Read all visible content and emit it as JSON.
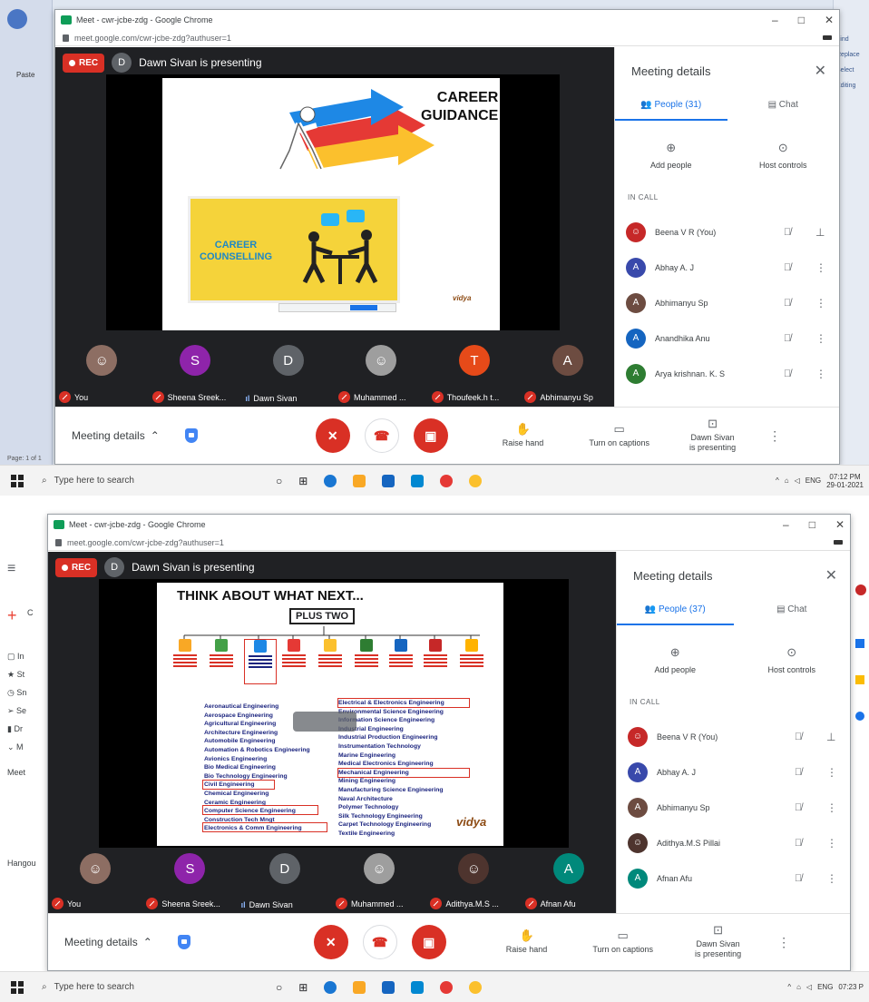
{
  "screens": [
    {
      "window_title": "Meet - cwr-jcbe-zdg - Google Chrome",
      "url": "meet.google.com/cwr-jcbe-zdg?authuser=1",
      "rec_label": "REC",
      "presenter_initial": "D",
      "presenting_text": "Dawn Sivan is presenting",
      "slide": {
        "title_line1": "CAREER",
        "title_line2": "GUIDANCE",
        "box_line1": "CAREER",
        "box_line2": "COUNSELLING",
        "logo_text": "vidya"
      },
      "tiles": [
        {
          "initial": "",
          "name": "You",
          "muted": true,
          "color": "#8d6e63"
        },
        {
          "initial": "S",
          "name": "Sheena Sreek...",
          "muted": true,
          "color": "#8e24aa"
        },
        {
          "initial": "D",
          "name": "Dawn Sivan",
          "muted": false,
          "color": "#5f6368"
        },
        {
          "initial": "",
          "name": "Muhammed ...",
          "muted": true,
          "color": "#9e9e9e"
        },
        {
          "initial": "T",
          "name": "Thoufeek.h t...",
          "muted": true,
          "color": "#e64a19"
        },
        {
          "initial": "A",
          "name": "Abhimanyu Sp",
          "muted": true,
          "color": "#6d4c41"
        }
      ],
      "bottom": {
        "meeting_details": "Meeting details",
        "raise_hand": "Raise hand",
        "captions": "Turn on captions",
        "presenting_line1": "Dawn Sivan",
        "presenting_line2": "is presenting"
      },
      "panel": {
        "title": "Meeting details",
        "people_tab": "People (31)",
        "chat_tab": "Chat",
        "add_people": "Add people",
        "host_controls": "Host controls",
        "in_call": "IN CALL",
        "people": [
          {
            "initial": "",
            "name": "Beena V R (You)",
            "color": "#c62828",
            "more": "pin"
          },
          {
            "initial": "A",
            "name": "Abhay A. J",
            "color": "#3949ab",
            "more": "more"
          },
          {
            "initial": "A",
            "name": "Abhimanyu Sp",
            "color": "#6d4c41",
            "more": "more"
          },
          {
            "initial": "A",
            "name": "Anandhika Anu",
            "color": "#1565c0",
            "more": "more"
          },
          {
            "initial": "A",
            "name": "Arya krishnan. K. S",
            "color": "#2e7d32",
            "more": "more"
          }
        ]
      },
      "taskbar": {
        "search": "Type here to search",
        "lang": "ENG",
        "time": "07:12 PM",
        "date": "29-01-2021"
      },
      "context": {
        "page": "Page: 1 of 1",
        "right_items": [
          "Find",
          "Replace",
          "Select",
          "Editing"
        ],
        "paste": "Paste"
      }
    },
    {
      "window_title": "Meet - cwr-jcbe-zdg - Google Chrome",
      "url": "meet.google.com/cwr-jcbe-zdg?authuser=1",
      "rec_label": "REC",
      "presenter_initial": "D",
      "presenting_text": "Dawn Sivan is presenting",
      "slide": {
        "title": "THINK ABOUT WHAT NEXT...",
        "subtitle": "PLUS TWO",
        "left_list": [
          "Aeronautical Engineering",
          "Aerospace Engineering",
          "Agricultural Engineering",
          "Architecture Engineering",
          "Automobile Engineering",
          "Automation & Robotics Engineering",
          "Avionics Engineering",
          "Bio Medical Engineering",
          "Bio Technology Engineering",
          "Civil Engineering",
          "Chemical Engineering",
          "Ceramic Engineering",
          "Computer Science Engineering",
          "Construction Tech Mngt",
          "Electronics & Comm Engineering"
        ],
        "right_list": [
          "Electrical & Electronics Engineering",
          "Environmental Science Engineering",
          "Information Science Engineering",
          "Industrial Engineering",
          "Industrial Production Engineering",
          "Instrumentation Technology",
          "Marine Engineering",
          "Medical Electronics Engineering",
          "Mechanical Engineering",
          "Mining Engineering",
          "Manufacturing Science Engineering",
          "Naval Architecture",
          "Polymer Technology",
          "Silk Technology Engineering",
          "Carpet Technology Engineering",
          "Textile Engineering"
        ],
        "logo_text": "vidya"
      },
      "tiles": [
        {
          "initial": "",
          "name": "You",
          "muted": true,
          "color": "#8d6e63"
        },
        {
          "initial": "S",
          "name": "Sheena Sreek...",
          "muted": true,
          "color": "#8e24aa"
        },
        {
          "initial": "D",
          "name": "Dawn Sivan",
          "muted": false,
          "color": "#5f6368"
        },
        {
          "initial": "",
          "name": "Muhammed ...",
          "muted": true,
          "color": "#9e9e9e"
        },
        {
          "initial": "",
          "name": "Adithya.M.S ...",
          "muted": true,
          "color": "#4e342e"
        },
        {
          "initial": "A",
          "name": "Afnan Afu",
          "muted": true,
          "color": "#00897b"
        }
      ],
      "bottom": {
        "meeting_details": "Meeting details",
        "raise_hand": "Raise hand",
        "captions": "Turn on captions",
        "presenting_line1": "Dawn Sivan",
        "presenting_line2": "is presenting"
      },
      "panel": {
        "title": "Meeting details",
        "people_tab": "People (37)",
        "chat_tab": "Chat",
        "add_people": "Add people",
        "host_controls": "Host controls",
        "in_call": "IN CALL",
        "people": [
          {
            "initial": "",
            "name": "Beena V R (You)",
            "color": "#c62828",
            "more": "pin"
          },
          {
            "initial": "A",
            "name": "Abhay A. J",
            "color": "#3949ab",
            "more": "more"
          },
          {
            "initial": "A",
            "name": "Abhimanyu Sp",
            "color": "#6d4c41",
            "more": "more"
          },
          {
            "initial": "",
            "name": "Adithya.M.S Pillai",
            "color": "#4e342e",
            "more": "more"
          },
          {
            "initial": "A",
            "name": "Afnan Afu",
            "color": "#00897b",
            "more": "more"
          }
        ]
      },
      "taskbar": {
        "search": "Type here to search",
        "lang": "ENG",
        "time": "07:23 P",
        "date": ""
      },
      "context": {
        "left_items": [
          "In",
          "St",
          "Sn",
          "Se",
          "Dr",
          "M"
        ],
        "meet": "Meet",
        "hangouts": "Hangou",
        "compose": "C"
      }
    }
  ],
  "colors": {
    "red": "#d93025",
    "blue": "#1a73e8",
    "dark": "#202124"
  }
}
